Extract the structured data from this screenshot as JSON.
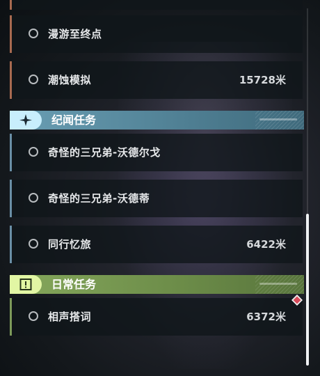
{
  "sections": {
    "main": {
      "items": [
        {
          "title": "漫游至终点",
          "distance": ""
        },
        {
          "title": "潮蚀模拟",
          "distance": "15728米"
        }
      ]
    },
    "story": {
      "title": "纪闻任务",
      "items": [
        {
          "title": "奇怪的三兄弟-沃德尔戈",
          "distance": ""
        },
        {
          "title": "奇怪的三兄弟-沃德蒂",
          "distance": ""
        },
        {
          "title": "同行忆旅",
          "distance": "6422米"
        }
      ]
    },
    "daily": {
      "title": "日常任务",
      "items": [
        {
          "title": "相声搭词",
          "distance": "6372米"
        }
      ]
    }
  },
  "icons": {
    "story_badge": "sparkle-icon",
    "daily_badge": "exclamation-icon",
    "tracked_marker": "red-diamond-icon"
  },
  "colors": {
    "story_accent": "#6a9fb4",
    "daily_accent": "#86a85c",
    "main_accent": "#a86a50",
    "marker_red": "#d84a5a"
  }
}
